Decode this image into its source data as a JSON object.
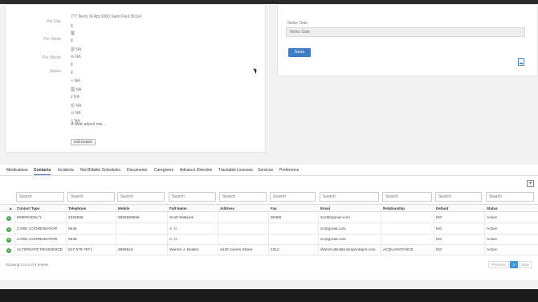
{
  "profile": {
    "rows": [
      {
        "label": "Per Day",
        "value": "777 Berry St Apt 2000 Saint Paul 55114"
      },
      {
        "label": "",
        "value": "8"
      },
      {
        "label": "Per Week",
        "value": "醫"
      },
      {
        "label": "",
        "value": "8"
      },
      {
        "label": "",
        "value": "語 NA"
      },
      {
        "label": "Per Month",
        "value": "⊘ NA"
      },
      {
        "label": "",
        "value": "8"
      },
      {
        "label": "",
        "value": "8"
      },
      {
        "label": "",
        "value": "⋄ NA"
      },
      {
        "label": "",
        "value": "國 NA"
      },
      {
        "label": "",
        "value": "∂ NA"
      },
      {
        "label": "",
        "value": "伦 NA"
      },
      {
        "label": "",
        "value": "⊙ NA"
      },
      {
        "label": "",
        "value": "Ξ NA"
      }
    ],
    "status_label": "Status",
    "about": "A little about me...",
    "edit_button": "Edit Details"
  },
  "notes": {
    "label": "Notes Date",
    "placeholder": "Notes Date",
    "save_button": "Save"
  },
  "tabs": [
    "Medications",
    "Contacts",
    "Incidents",
    "Not Billable Schedules",
    "Documents",
    "Caregivers",
    "Advance Directive",
    "Trackable Licenses",
    "Services",
    "Preference"
  ],
  "active_tab": "Contacts",
  "grid": {
    "search_placeholder": "Search",
    "columns": [
      "Contact Type",
      "Telephone",
      "Mobile",
      "Full Name",
      "Address",
      "Fax",
      "Email",
      "Relationship",
      "Default",
      "Status"
    ],
    "rows": [
      [
        "EMERGENCY",
        "2225555",
        "5555556666",
        "Scott Williams",
        "",
        "56456",
        "scott@gmail.com",
        "",
        "NO",
        "Active"
      ],
      [
        "CARE COORDINATOR",
        "5646",
        "",
        "A. C.",
        "",
        "",
        "sc@gmail.com",
        "",
        "NO",
        "Active"
      ],
      [
        "CARE COORDINATOR",
        "5646",
        "",
        "A. C.",
        "",
        "",
        "sc@gmail.com",
        "",
        "NO",
        "Active"
      ],
      [
        "ALTERNATE RESIDENCE",
        "817-578-7871",
        "9856516",
        "Warren J. Bodkin",
        "4430 James Street",
        "2312",
        "WarrenJBodkin@sprintspot.com",
        "ACQUAINTANCE",
        "NO",
        "Active"
      ]
    ],
    "footer": "Showing 1 to 4 of 4 entries",
    "pager": {
      "previous": "Previous",
      "page": "1",
      "next": "Next"
    }
  }
}
